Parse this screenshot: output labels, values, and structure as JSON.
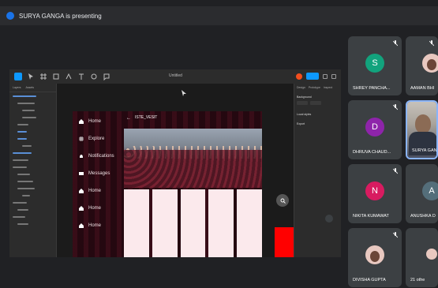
{
  "window": {
    "presenting_text": "SURYA GANGA is presenting"
  },
  "figma": {
    "file_name": "Untitled",
    "layers_tabs": [
      "Layers",
      "Assets"
    ],
    "props_tabs": [
      "Design",
      "Prototype",
      "Inspect"
    ],
    "props_sections": [
      "Background",
      "Local styles",
      "Export"
    ]
  },
  "prototype": {
    "post_user": "ISTE_VESIT",
    "nav_items": [
      {
        "label": "Home",
        "icon": "home-icon"
      },
      {
        "label": "Explore",
        "icon": "hash-icon"
      },
      {
        "label": "Notifications",
        "icon": "bell-icon"
      },
      {
        "label": "Messages",
        "icon": "mail-icon"
      },
      {
        "label": "Home",
        "icon": "home-icon"
      },
      {
        "label": "Home",
        "icon": "home-icon"
      },
      {
        "label": "Home",
        "icon": "home-icon"
      }
    ],
    "search_icon": "search-icon"
  },
  "participants": [
    {
      "name": "SHREY PANCHA...",
      "initial": "S",
      "color": "#12a37d",
      "type": "initial"
    },
    {
      "name": "AAMAN BHI",
      "type": "photo"
    },
    {
      "name": "DHRUVA CHAUD...",
      "initial": "D",
      "color": "#8e24aa",
      "type": "initial"
    },
    {
      "name": "SURYA GAN",
      "type": "camera",
      "active": true
    },
    {
      "name": "NIKITA KUMAWAT",
      "initial": "N",
      "color": "#d81b60",
      "type": "initial"
    },
    {
      "name": "ANUSHKA D",
      "initial": "A",
      "color": "#546e7a",
      "type": "initial"
    },
    {
      "name": "DIVISHA GUPTA",
      "type": "photo"
    },
    {
      "name": "21 othe",
      "type": "others"
    }
  ],
  "colors": {
    "accent": "#1a73e8",
    "figma_blue": "#0d99ff",
    "proto_red": "#ff0000",
    "grid_pink": "#fbe9ec"
  }
}
